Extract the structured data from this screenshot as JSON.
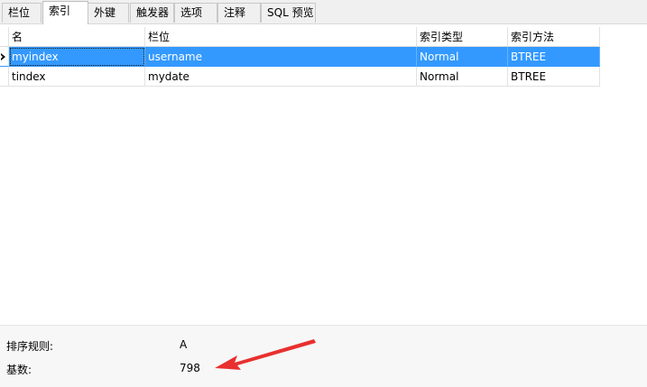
{
  "tabs": [
    {
      "label": "栏位",
      "active": false
    },
    {
      "label": "索引",
      "active": true
    },
    {
      "label": "外键",
      "active": false
    },
    {
      "label": "触发器",
      "active": false
    },
    {
      "label": "选项",
      "active": false
    },
    {
      "label": "注释",
      "active": false
    },
    {
      "label": "SQL 预览",
      "active": false
    }
  ],
  "grid": {
    "columns": [
      "名",
      "栏位",
      "索引类型",
      "索引方法"
    ],
    "rows": [
      {
        "name": "myindex",
        "column": "username",
        "type": "Normal",
        "method": "BTREE",
        "selected": true
      },
      {
        "name": "tindex",
        "column": "mydate",
        "type": "Normal",
        "method": "BTREE",
        "selected": false
      }
    ]
  },
  "properties": {
    "collation_label": "排序规则:",
    "collation_value": "A",
    "cardinality_label": "基数:",
    "cardinality_value": "798"
  },
  "colors": {
    "selection": "#3399ff",
    "annotation_arrow": "#e8302f"
  }
}
